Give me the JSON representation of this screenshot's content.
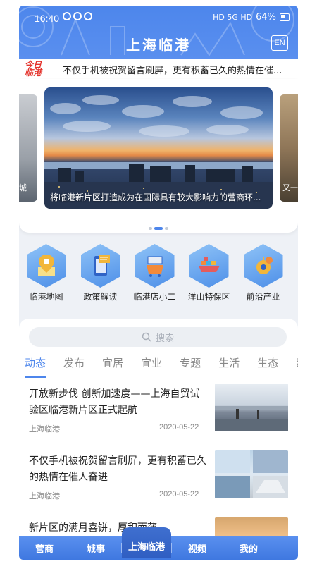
{
  "status": {
    "time": "16:40",
    "battery_text": "64%",
    "network_label": "HD 5G HD"
  },
  "header": {
    "title": "上海临港",
    "lang_button": "EN"
  },
  "ticker": {
    "logo_line1": "今日",
    "logo_line2": "临港",
    "text": "不仅手机被祝贺留言刷屏，更有积蓄已久的热情在催..."
  },
  "banner": {
    "prev_caption": "城",
    "main_caption": "将临港新片区打造成为在国际具有较大影响力的营商环...",
    "next_caption": "又一",
    "pages": 3,
    "active_page": 2
  },
  "categories": [
    {
      "label": "临港地图",
      "icon": "map-pin-icon"
    },
    {
      "label": "政策解读",
      "icon": "phone-doc-icon"
    },
    {
      "label": "临港店小二",
      "icon": "cart-icon"
    },
    {
      "label": "洋山特保区",
      "icon": "ship-icon"
    },
    {
      "label": "前沿产业",
      "icon": "gear-icon"
    }
  ],
  "search": {
    "placeholder": "搜索"
  },
  "tabs": [
    "动态",
    "发布",
    "宜居",
    "宜业",
    "专题",
    "生活",
    "生态",
    "建设"
  ],
  "active_tab": 0,
  "news": [
    {
      "title": "开放新步伐 创新加速度——上海自贸试验区临港新片区正式起航",
      "source": "上海临港",
      "date": "2020-05-22"
    },
    {
      "title": "不仅手机被祝贺留言刷屏，更有积蓄已久的热情在催人奋进",
      "source": "上海临港",
      "date": "2020-05-22"
    },
    {
      "title": "新片区的满月喜饼，厚积而薄",
      "source": "",
      "date": ""
    }
  ],
  "bottom_nav": [
    "营商",
    "城事",
    "上海临港",
    "视频",
    "我的"
  ],
  "bottom_nav_active": 2
}
